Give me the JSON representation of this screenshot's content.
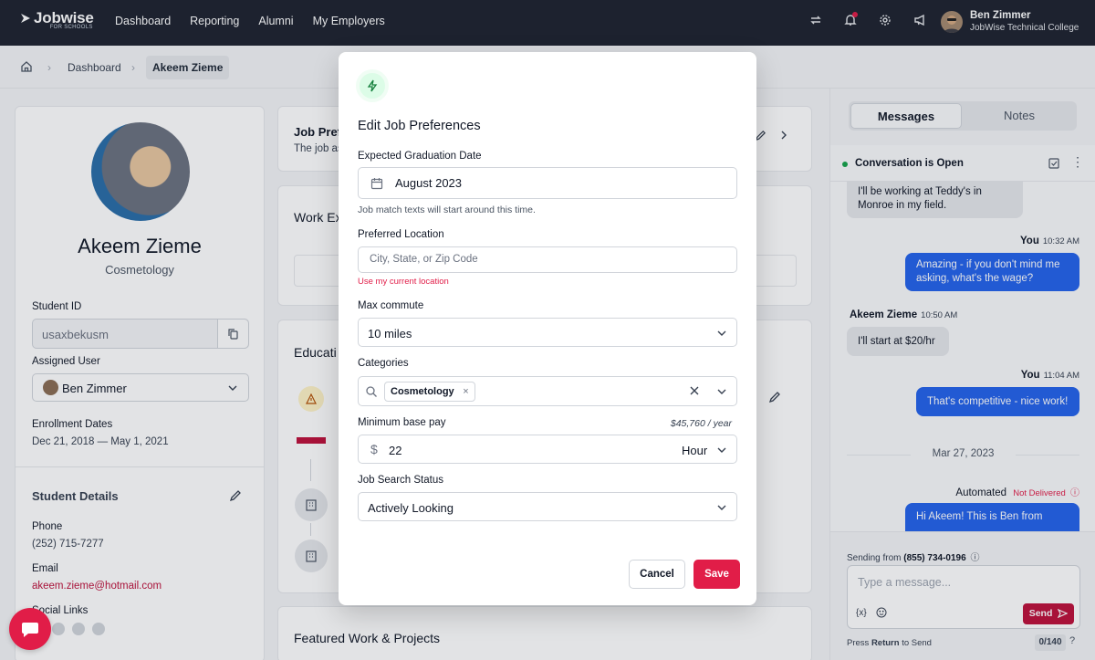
{
  "nav": {
    "brand": "Jobwise",
    "brand_sub": "FOR SCHOOLS",
    "links": [
      "Dashboard",
      "Reporting",
      "Alumni",
      "My Employers"
    ],
    "user_name": "Ben Zimmer",
    "user_org": "JobWise Technical College"
  },
  "breadcrumb": {
    "items": [
      "Dashboard",
      "Akeem Zieme"
    ]
  },
  "profile": {
    "name": "Akeem Zieme",
    "program": "Cosmetology",
    "student_id_label": "Student ID",
    "student_id": "usaxbekusm",
    "assigned_user_label": "Assigned User",
    "assigned_user": "Ben Zimmer",
    "enrollment_label": "Enrollment Dates",
    "enrollment_dates": "Dec 21, 2018 — May 1, 2021",
    "details_title": "Student Details",
    "phone_label": "Phone",
    "phone": "(252) 715-7277",
    "email_label": "Email",
    "email": "akeem.zieme@hotmail.com",
    "social_label": "Social Links"
  },
  "middle": {
    "job_pref_title": "Job Pref",
    "job_pref_sub": "The job as",
    "work_title": "Work Ex",
    "education_title": "Educati",
    "featured_title": "Featured Work & Projects"
  },
  "messages_panel": {
    "tabs": [
      "Messages",
      "Notes"
    ],
    "conversation_status": "Conversation is Open",
    "msg1": "I'll be working at Teddy's in Monroe in my field.",
    "meta2_name": "You",
    "meta2_time": "10:32 AM",
    "msg2": "Amazing - if you don't mind me asking, what's the wage?",
    "meta3_name": "Akeem Zieme",
    "meta3_time": "10:50 AM",
    "msg3": "I'll start at $20/hr",
    "meta4_name": "You",
    "meta4_time": "11:04 AM",
    "msg4": "That's competitive - nice work!",
    "date_sep": "Mar 27, 2023",
    "meta5_name": "Automated",
    "meta5_status": "Not Delivered",
    "msg5": "Hi Akeem! This is Ben from",
    "sending_from_label": "Sending from",
    "sending_from_number": "(855) 734-0196",
    "placeholder": "Type a message...",
    "var_token": "{x}",
    "send_label": "Send",
    "hint_pre": "Press",
    "hint_key": "Return",
    "hint_post": "to Send",
    "char_count": "0/140"
  },
  "modal": {
    "title": "Edit Job Preferences",
    "grad_label": "Expected Graduation Date",
    "grad_value": "August 2023",
    "grad_help": "Job match texts will start around this time.",
    "location_label": "Preferred Location",
    "location_placeholder": "City, State, or Zip Code",
    "location_link": "Use my current location",
    "commute_label": "Max commute",
    "commute_value": "10 miles",
    "categories_label": "Categories",
    "category_chip": "Cosmetology",
    "pay_label": "Minimum base pay",
    "pay_annual": "$45,760 / year",
    "pay_value": "22",
    "pay_unit": "Hour",
    "status_label": "Job Search Status",
    "status_value": "Actively Looking",
    "cancel_label": "Cancel",
    "save_label": "Save"
  }
}
